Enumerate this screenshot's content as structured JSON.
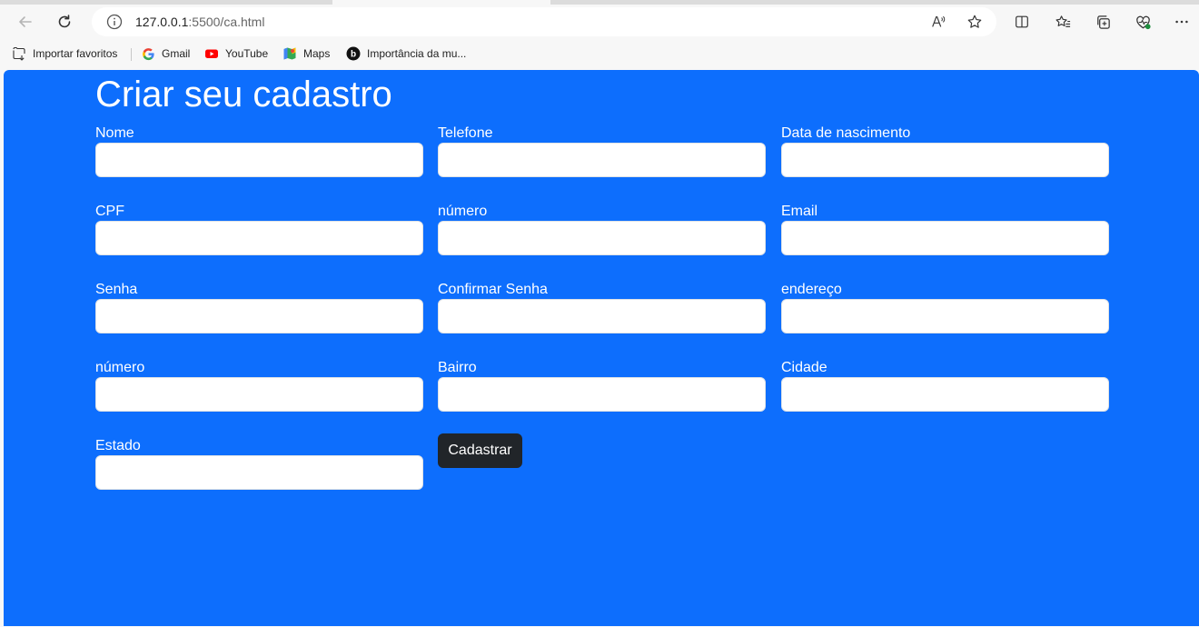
{
  "browser": {
    "url_host": "127.0.0.1",
    "url_rest": ":5500/ca.html",
    "bookmarks": [
      {
        "label": "Importar favoritos",
        "icon": "import-favorites-icon"
      },
      {
        "label": "Gmail",
        "icon": "google-icon"
      },
      {
        "label": "YouTube",
        "icon": "youtube-icon"
      },
      {
        "label": "Maps",
        "icon": "maps-icon"
      },
      {
        "label": "Importância da mu...",
        "icon": "b-icon"
      }
    ]
  },
  "form": {
    "title": "Criar seu cadastro",
    "fields": {
      "nome": "Nome",
      "telefone": "Telefone",
      "nascimento": "Data de nascimento",
      "cpf": "CPF",
      "numero1": "número",
      "email": "Email",
      "senha": "Senha",
      "confirmar_senha": "Confirmar Senha",
      "endereco": "endereço",
      "numero2": "número",
      "bairro": "Bairro",
      "cidade": "Cidade",
      "estado": "Estado"
    },
    "submit_label": "Cadastrar"
  },
  "colors": {
    "page_background": "#0d6efd",
    "button_background": "#212529"
  }
}
